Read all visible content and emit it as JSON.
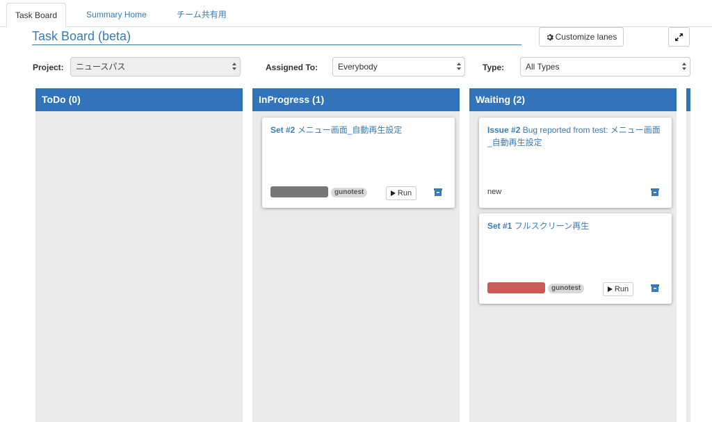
{
  "tabs": [
    {
      "label": "Task Board",
      "active": true
    },
    {
      "label": "Summary Home",
      "active": false
    },
    {
      "label": "チーム共有用",
      "active": false
    }
  ],
  "page": {
    "title": "Task Board (beta)",
    "customize_label": "Customize lanes",
    "expand_icon": "expand-icon",
    "customize_icon": "gear-icon"
  },
  "filters": {
    "project": {
      "label": "Project:",
      "value": "ニュースパス"
    },
    "assigned": {
      "label": "Assigned To:",
      "value": "Everybody"
    },
    "type": {
      "label": "Type:",
      "value": "All Types"
    }
  },
  "lanes": [
    {
      "title": "ToDo (0)"
    },
    {
      "title": "InProgress (1)"
    },
    {
      "title": "Waiting (2)"
    }
  ],
  "cards": {
    "inprogress_set2": {
      "id": "Set #2",
      "title": "メニュー画面_自動再生設定",
      "tag": "gunotest",
      "run_label": "Run",
      "bar_color": "#777777"
    },
    "waiting_issue2": {
      "id": "Issue #2",
      "title": "Bug reported from test: メニュー画面_自動再生設定",
      "status": "new"
    },
    "waiting_set1": {
      "id": "Set #1",
      "title": "フルスクリーン再生",
      "tag": "gunotest",
      "run_label": "Run",
      "bar_color": "#cc5a55"
    }
  },
  "colors": {
    "accent": "#3274b9",
    "lane_bg": "#ebebeb",
    "link": "#3a7bb5"
  }
}
